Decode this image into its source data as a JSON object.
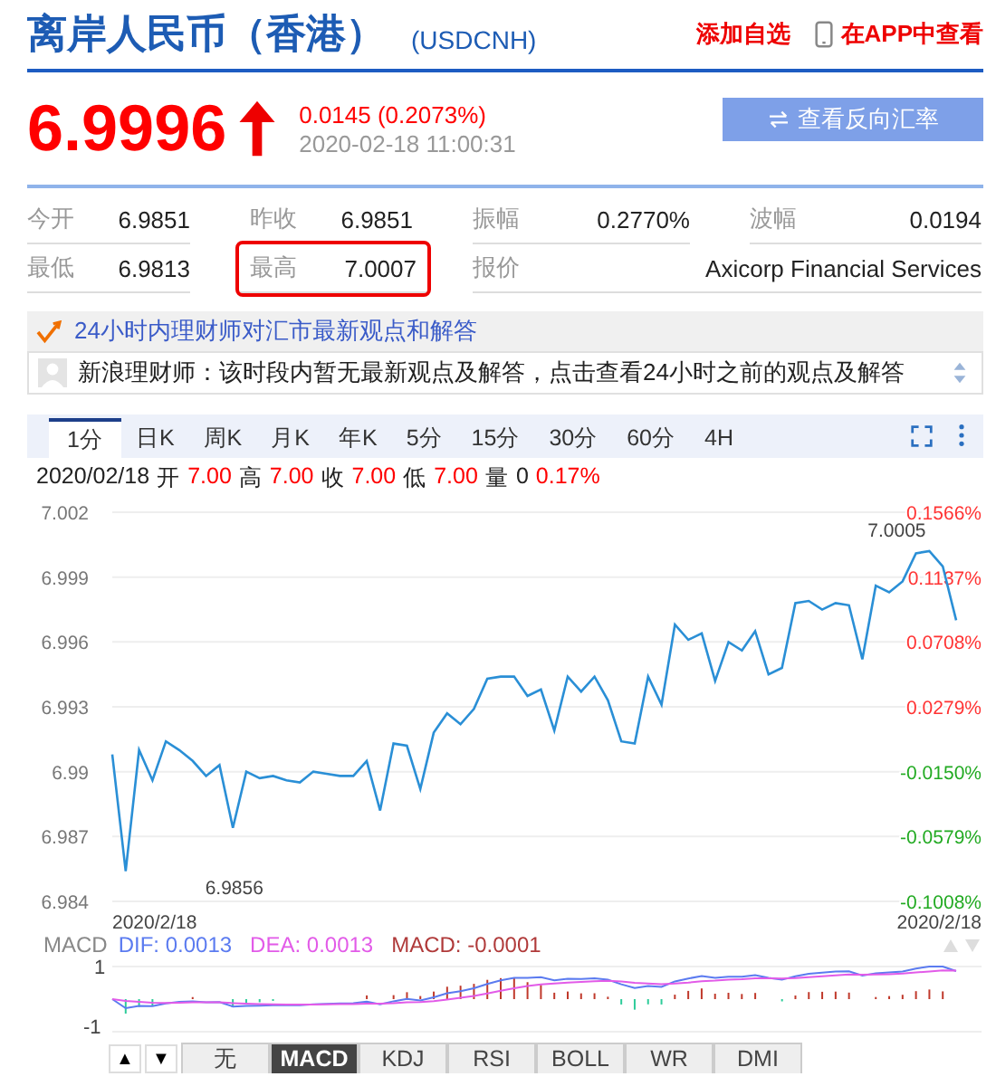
{
  "header": {
    "title": "离岸人民币（香港）",
    "code": "(USDCNH)",
    "add_watchlist": "添加自选",
    "app_link": "在APP中查看"
  },
  "quote": {
    "price": "6.9996",
    "up": true,
    "change": "0.0145 (0.2073%)",
    "time": "2020-02-18 11:00:31",
    "reverse_button": "查看反向汇率"
  },
  "stats": [
    [
      {
        "label": "今开",
        "value": "6.9851",
        "kind": "normal",
        "highlighted": false
      },
      {
        "label": "昨收",
        "value": "6.9851",
        "kind": "normal",
        "highlighted": false
      },
      {
        "label": "振幅",
        "value": "0.2770%",
        "kind": "normal",
        "highlighted": false
      },
      {
        "label": "波幅",
        "value": "0.0194",
        "kind": "normal",
        "highlighted": false
      }
    ],
    [
      {
        "label": "最低",
        "value": "6.9813",
        "kind": "normal",
        "highlighted": false
      },
      {
        "label": "最高",
        "value": "7.0007",
        "kind": "normal",
        "highlighted": true
      },
      {
        "label": "报价",
        "value": "Axicorp Financial Services",
        "kind": "wide",
        "highlighted": false
      }
    ]
  ],
  "opinions": {
    "title": "24小时内理财师对汇市最新观点和解答",
    "message": "新浪理财师：该时段内暂无最新观点及解答，点击查看24小时之前的观点及解答"
  },
  "chart_tabs": [
    {
      "label": "1分",
      "selected": true
    },
    {
      "label": "日K",
      "selected": false
    },
    {
      "label": "周K",
      "selected": false
    },
    {
      "label": "月K",
      "selected": false
    },
    {
      "label": "年K",
      "selected": false
    },
    {
      "label": "5分",
      "selected": false
    },
    {
      "label": "15分",
      "selected": false
    },
    {
      "label": "30分",
      "selected": false
    },
    {
      "label": "60分",
      "selected": false
    },
    {
      "label": "4H",
      "selected": false
    }
  ],
  "bar_info": {
    "date": "2020/02/18",
    "items": [
      {
        "label": "开",
        "value": "7.00",
        "kind": "price"
      },
      {
        "label": "高",
        "value": "7.00",
        "kind": "price"
      },
      {
        "label": "收",
        "value": "7.00",
        "kind": "price"
      },
      {
        "label": "低",
        "value": "7.00",
        "kind": "price"
      },
      {
        "label": "量",
        "value": "0",
        "kind": "volume"
      }
    ],
    "change": "0.17%"
  },
  "chart": {
    "chart_data": {
      "type": "line",
      "grid": true,
      "ylim": [
        6.984,
        7.002
      ],
      "yticks": [
        7.002,
        6.999,
        6.996,
        6.993,
        {
          "value": 6.99,
          "label": "6.99"
        },
        6.987,
        6.984
      ],
      "series": [
        {
          "color": "#2a8fd6",
          "values": [
            6.9908,
            6.9854,
            6.991,
            6.9896,
            6.9914,
            6.991,
            6.9905,
            6.9898,
            6.9903,
            6.9874,
            6.99,
            6.9897,
            6.9898,
            6.9896,
            6.9895,
            6.99,
            6.9899,
            6.9898,
            6.9898,
            6.9905,
            6.9882,
            6.9913,
            6.9912,
            6.9892,
            6.9918,
            6.9927,
            6.9922,
            6.9929,
            6.9943,
            6.9944,
            6.9944,
            6.9935,
            6.9938,
            6.9919,
            6.9944,
            6.9937,
            6.9944,
            6.9933,
            6.9914,
            6.9913,
            6.9944,
            6.9931,
            6.9968,
            6.9961,
            6.9964,
            6.9942,
            6.996,
            6.9956,
            6.9965,
            6.9945,
            6.9948,
            6.9978,
            6.9979,
            6.9975,
            6.9978,
            6.9977,
            6.9952,
            6.9986,
            6.9983,
            6.9988,
            7.0001,
            7.0002,
            6.9995,
            6.997
          ]
        }
      ]
    },
    "max_label": "7.0005",
    "min_label": "6.9856",
    "x_labels": [
      "2020/2/18",
      "2020/2/18"
    ],
    "right_ticks": [
      {
        "label": "0.1566%",
        "color": "#ff3333"
      },
      {
        "label": "0.1137%",
        "color": "#ff3333"
      },
      {
        "label": "0.0708%",
        "color": "#ff3333"
      },
      {
        "label": "0.0279%",
        "color": "#ff3333"
      },
      {
        "label": "-0.0150%",
        "color": "#22aa22"
      },
      {
        "label": "-0.0579%",
        "color": "#22aa22"
      },
      {
        "label": "-0.1008%",
        "color": "#22aa22"
      }
    ]
  },
  "macd": {
    "name": "MACD",
    "dif": "DIF: 0.0013",
    "dea": "DEA: 0.0013",
    "macd": "MACD: -0.0001",
    "top_tick": "1",
    "bottom_tick": "-1"
  },
  "indicator_tabs": {
    "up": "▲",
    "down": "▼",
    "tabs": [
      {
        "label": "无",
        "selected": false
      },
      {
        "label": "MACD",
        "selected": true
      },
      {
        "label": "KDJ",
        "selected": false
      },
      {
        "label": "RSI",
        "selected": false
      },
      {
        "label": "BOLL",
        "selected": false
      },
      {
        "label": "WR",
        "selected": false
      },
      {
        "label": "DMI",
        "selected": false
      }
    ]
  }
}
